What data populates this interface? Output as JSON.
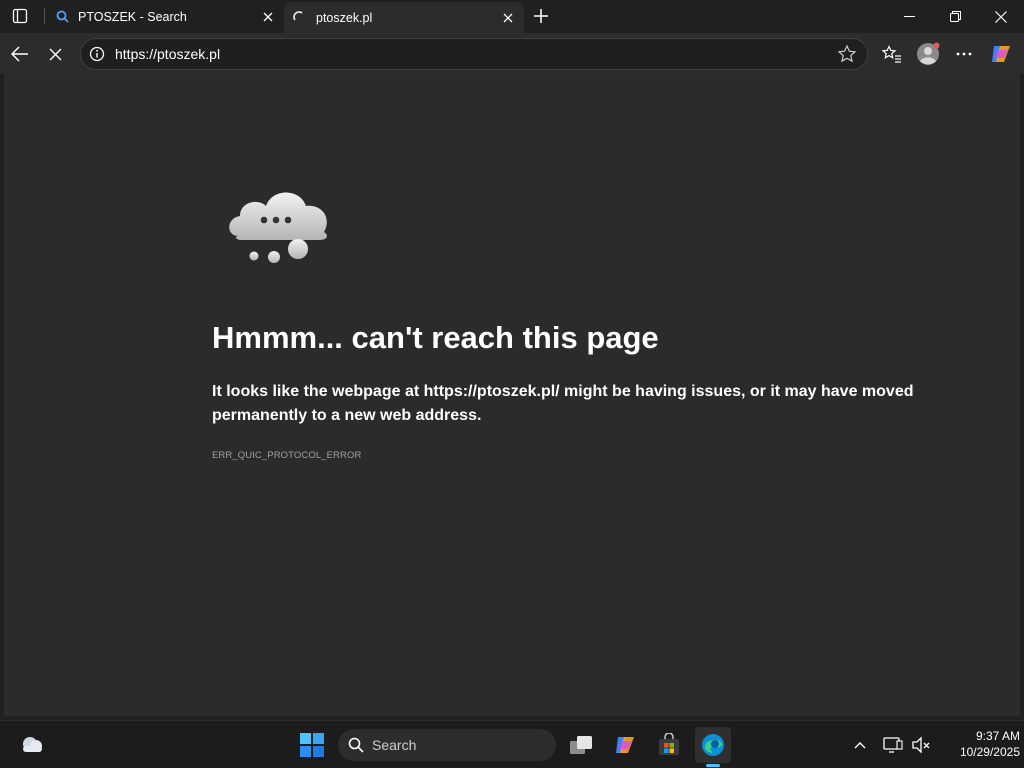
{
  "tabs": [
    {
      "title": "PTOSZEK - Search",
      "icon": "search-icon"
    },
    {
      "title": "ptoszek.pl",
      "icon": "loading-spinner-icon"
    }
  ],
  "address_bar": {
    "url": "https://ptoszek.pl"
  },
  "error_page": {
    "heading": "Hmmm... can't reach this page",
    "desc_prefix": "It looks like the webpage at ",
    "desc_url": "https://ptoszek.pl/",
    "desc_suffix": " might be having issues, or it may have moved permanently to a new web address.",
    "error_code": "ERR_QUIC_PROTOCOL_ERROR"
  },
  "taskbar": {
    "search_label": "Search",
    "time": "9:37 AM",
    "date": "10/29/2025"
  },
  "colors": {
    "accent": "#4cc2ff",
    "page_bg": "#2b2b2b",
    "chrome_bg": "#202020"
  }
}
